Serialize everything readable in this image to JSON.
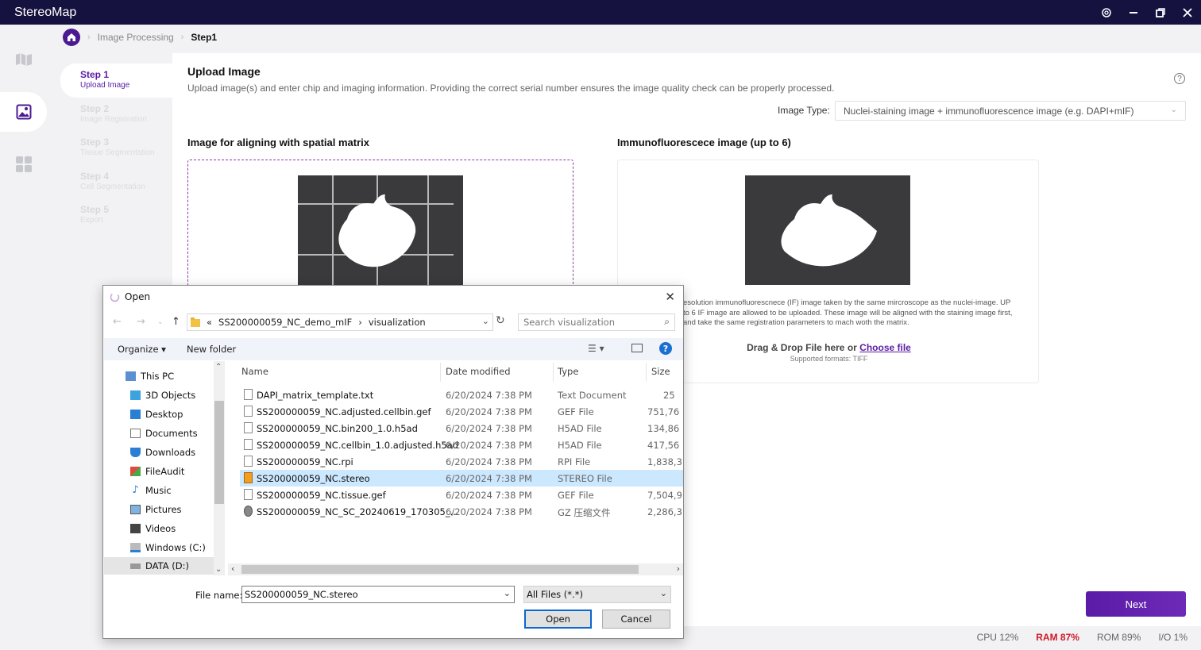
{
  "window": {
    "title": "StereoMap"
  },
  "breadcrumb": {
    "parent": "Image Processing",
    "current": "Step1"
  },
  "steps": [
    {
      "title": "Step 1",
      "desc": "Upload Image"
    },
    {
      "title": "Step 2",
      "desc": "Image Registration"
    },
    {
      "title": "Step 3",
      "desc": "Tissue Segmentation"
    },
    {
      "title": "Step 4",
      "desc": "Cell Segmentation"
    },
    {
      "title": "Step 5",
      "desc": "Export"
    }
  ],
  "main": {
    "title": "Upload Image",
    "description": "Upload image(s) and enter chip and imaging information. Providing the correct serial number ensures the image quality check can be properly processed.",
    "image_type_label": "Image Type:",
    "image_type_value": "Nuclei-staining image + immunofluorescence image (e.g. DAPI+mIF)",
    "left_panel_title": "Image for aligning with spatial matrix",
    "right_panel_title": "Immunofluorescece image (up to 6)",
    "if_note": "esolution immunofluorescnece (IF) image taken by the same mircroscope as the nuclei-image. UP to 6 IF image are allowed to be uploaded. These image will be aligned with the staining image first, and take the same registration parameters to mach woth the matrix.",
    "drag_drop_text": "Drag & Drop File here or",
    "choose_file": "Choose file",
    "supported_formats": "Supported formats: TIFF",
    "next_label": "Next"
  },
  "status": {
    "cpu": "CPU  12%",
    "ram": "RAM  87%",
    "rom": "ROM  89%",
    "io": "I/O  1%"
  },
  "dialog": {
    "title": "Open",
    "path_prefix": "«",
    "path_parts": [
      "SS200000059_NC_demo_mIF",
      "visualization"
    ],
    "search_placeholder": "Search visualization",
    "organize": "Organize ▾",
    "new_folder": "New folder",
    "nav_items": [
      "This PC",
      "3D Objects",
      "Desktop",
      "Documents",
      "Downloads",
      "FileAudit",
      "Music",
      "Pictures",
      "Videos",
      "Windows (C:)",
      "DATA (D:)"
    ],
    "columns": [
      "Name",
      "Date modified",
      "Type",
      "Size"
    ],
    "files": [
      {
        "name": "DAPI_matrix_template.txt",
        "date": "6/20/2024 7:38 PM",
        "type": "Text Document",
        "size": "25"
      },
      {
        "name": "SS200000059_NC.adjusted.cellbin.gef",
        "date": "6/20/2024 7:38 PM",
        "type": "GEF File",
        "size": "751,76"
      },
      {
        "name": "SS200000059_NC.bin200_1.0.h5ad",
        "date": "6/20/2024 7:38 PM",
        "type": "H5AD File",
        "size": "134,86"
      },
      {
        "name": "SS200000059_NC.cellbin_1.0.adjusted.h5ad",
        "date": "6/20/2024 7:38 PM",
        "type": "H5AD File",
        "size": "417,56"
      },
      {
        "name": "SS200000059_NC.rpi",
        "date": "6/20/2024 7:38 PM",
        "type": "RPI File",
        "size": "1,838,3"
      },
      {
        "name": "SS200000059_NC.stereo",
        "date": "6/20/2024 7:38 PM",
        "type": "STEREO File",
        "size": ""
      },
      {
        "name": "SS200000059_NC.tissue.gef",
        "date": "6/20/2024 7:38 PM",
        "type": "GEF File",
        "size": "7,504,9"
      },
      {
        "name": "SS200000059_NC_SC_20240619_170305_...",
        "date": "6/20/2024 7:38 PM",
        "type": "GZ 压缩文件",
        "size": "2,286,3"
      }
    ],
    "file_name_label": "File name:",
    "file_name_value": "SS200000059_NC.stereo",
    "file_type_value": "All Files (*.*)",
    "open_label": "Open",
    "cancel_label": "Cancel"
  },
  "colors": {
    "accent": "#5a1ea5",
    "titlebar": "#161240",
    "ram_alert": "#d11a2a",
    "selection": "#cce8ff"
  }
}
